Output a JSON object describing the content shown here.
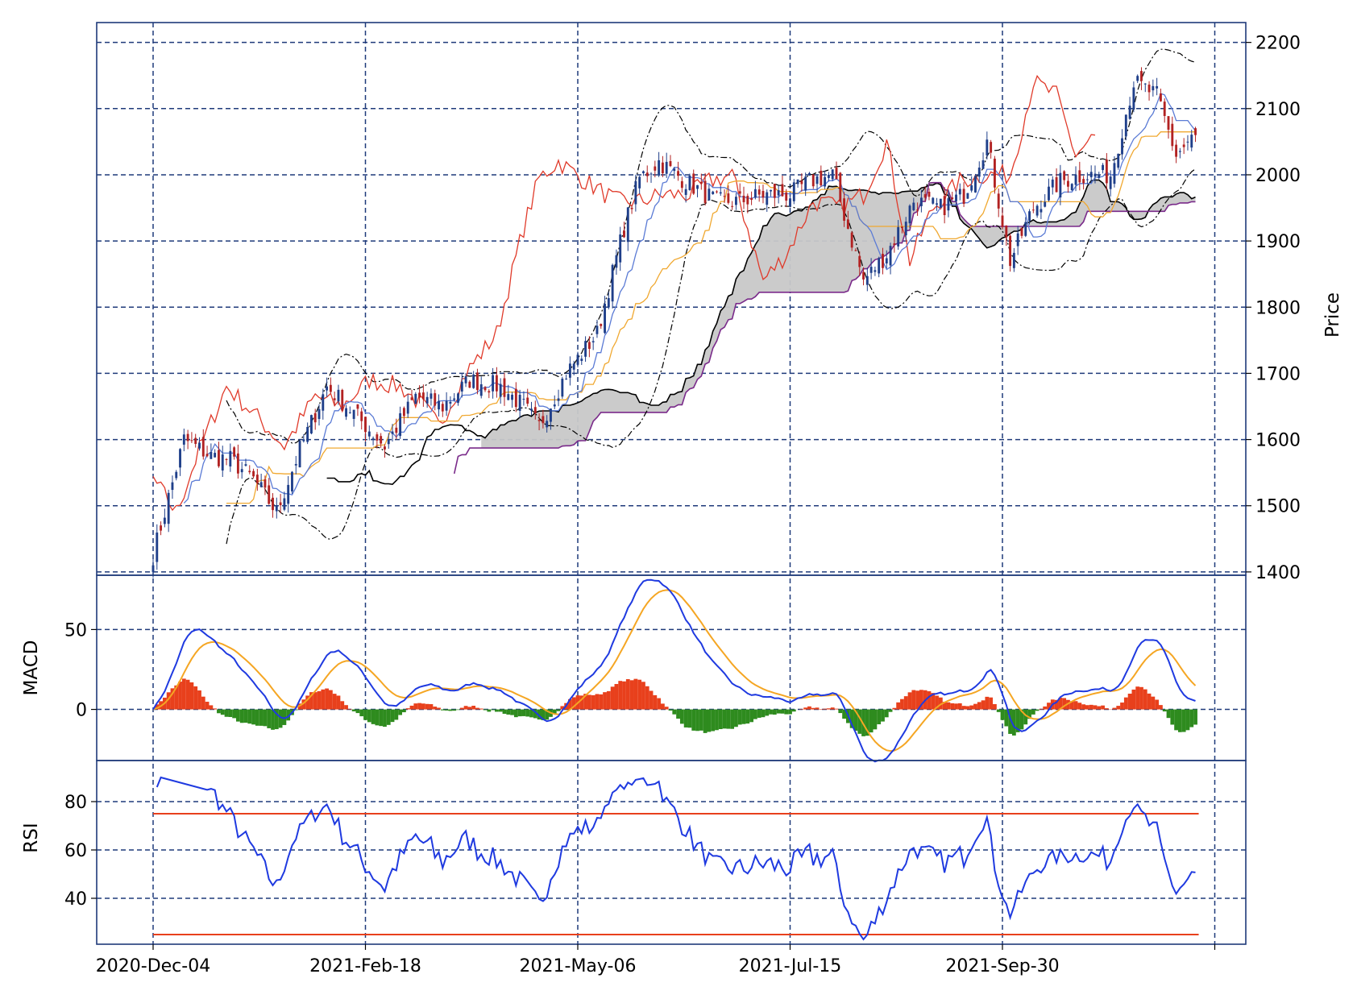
{
  "chart_data": [
    {
      "panel": "price",
      "type": "candlestick",
      "ylabel": "Price",
      "ylim": [
        1395,
        2230
      ],
      "yticks": [
        1400,
        1500,
        1600,
        1700,
        1800,
        1900,
        2000,
        2100,
        2200
      ],
      "ytick_labels": [
        "1400",
        "1500",
        "1600",
        "1700",
        "1800",
        "1900",
        "2000",
        "2100",
        "2200"
      ],
      "ytick_side": "right",
      "grid": true,
      "colors": {
        "up": "#1f3f8a",
        "down": "#b22222",
        "tenkan": "#5b7bd5",
        "kijun": "#f0a830",
        "chikou": "#e03a2a",
        "span_a": "#000000",
        "span_b": "#7a2a8a",
        "cloud": "#c8c8c8",
        "bollinger": "#000000"
      },
      "anchors": [
        [
          0,
          1425
        ],
        [
          8,
          1600
        ],
        [
          15,
          1575
        ],
        [
          20,
          1570
        ],
        [
          26,
          1540
        ],
        [
          32,
          1490
        ],
        [
          38,
          1585
        ],
        [
          45,
          1680
        ],
        [
          52,
          1640
        ],
        [
          60,
          1590
        ],
        [
          68,
          1665
        ],
        [
          75,
          1650
        ],
        [
          82,
          1690
        ],
        [
          90,
          1680
        ],
        [
          96,
          1650
        ],
        [
          100,
          1620
        ],
        [
          107,
          1700
        ],
        [
          115,
          1760
        ],
        [
          122,
          1920
        ],
        [
          126,
          1995
        ],
        [
          131,
          2020
        ],
        [
          138,
          1990
        ],
        [
          146,
          1960
        ],
        [
          152,
          1960
        ],
        [
          158,
          1970
        ],
        [
          165,
          1970
        ],
        [
          170,
          1990
        ],
        [
          176,
          2000
        ],
        [
          184,
          1840
        ],
        [
          190,
          1880
        ],
        [
          197,
          1960
        ],
        [
          204,
          1950
        ],
        [
          210,
          1970
        ],
        [
          216,
          2050
        ],
        [
          222,
          1870
        ],
        [
          228,
          1950
        ],
        [
          235,
          1990
        ],
        [
          241,
          2000
        ],
        [
          248,
          2000
        ],
        [
          254,
          2140
        ],
        [
          260,
          2120
        ],
        [
          265,
          2030
        ],
        [
          270,
          2060
        ]
      ],
      "tenkan_start": 8,
      "kijun_start": 19,
      "chikou_end": 246,
      "span_a_start": 26,
      "span_b_start": 85,
      "cloud_range": [
        85,
        270
      ],
      "bollinger_start": 19
    },
    {
      "panel": "macd",
      "type": "line+bar",
      "ylabel": "MACD",
      "ylim": [
        -32,
        84
      ],
      "yticks": [
        0,
        50
      ],
      "ytick_labels": [
        "0",
        "50"
      ],
      "grid": true,
      "colors": {
        "macd": "#1f3ae0",
        "signal": "#f5a623",
        "hist_pos": "#e8401c",
        "hist_neg": "#2e8b1e"
      }
    },
    {
      "panel": "rsi",
      "type": "line",
      "ylabel": "RSI",
      "ylim": [
        21,
        97
      ],
      "yticks": [
        40,
        60,
        80
      ],
      "ytick_labels": [
        "40",
        "60",
        "80"
      ],
      "hlines": [
        75,
        25
      ],
      "grid": true,
      "colors": {
        "rsi": "#1f3ae0",
        "bounds": "#e8401c"
      }
    }
  ],
  "x_axis": {
    "n_points": 271,
    "ticks": [
      0,
      55,
      110,
      165,
      220,
      275
    ],
    "tick_labels": [
      "2020-Dec-04",
      "2021-Feb-18",
      "2021-May-06",
      "2021-Jul-15",
      "2021-Sep-30",
      ""
    ]
  },
  "frame_color": "#1f3a7a",
  "grid_color": "#1f3a7a"
}
